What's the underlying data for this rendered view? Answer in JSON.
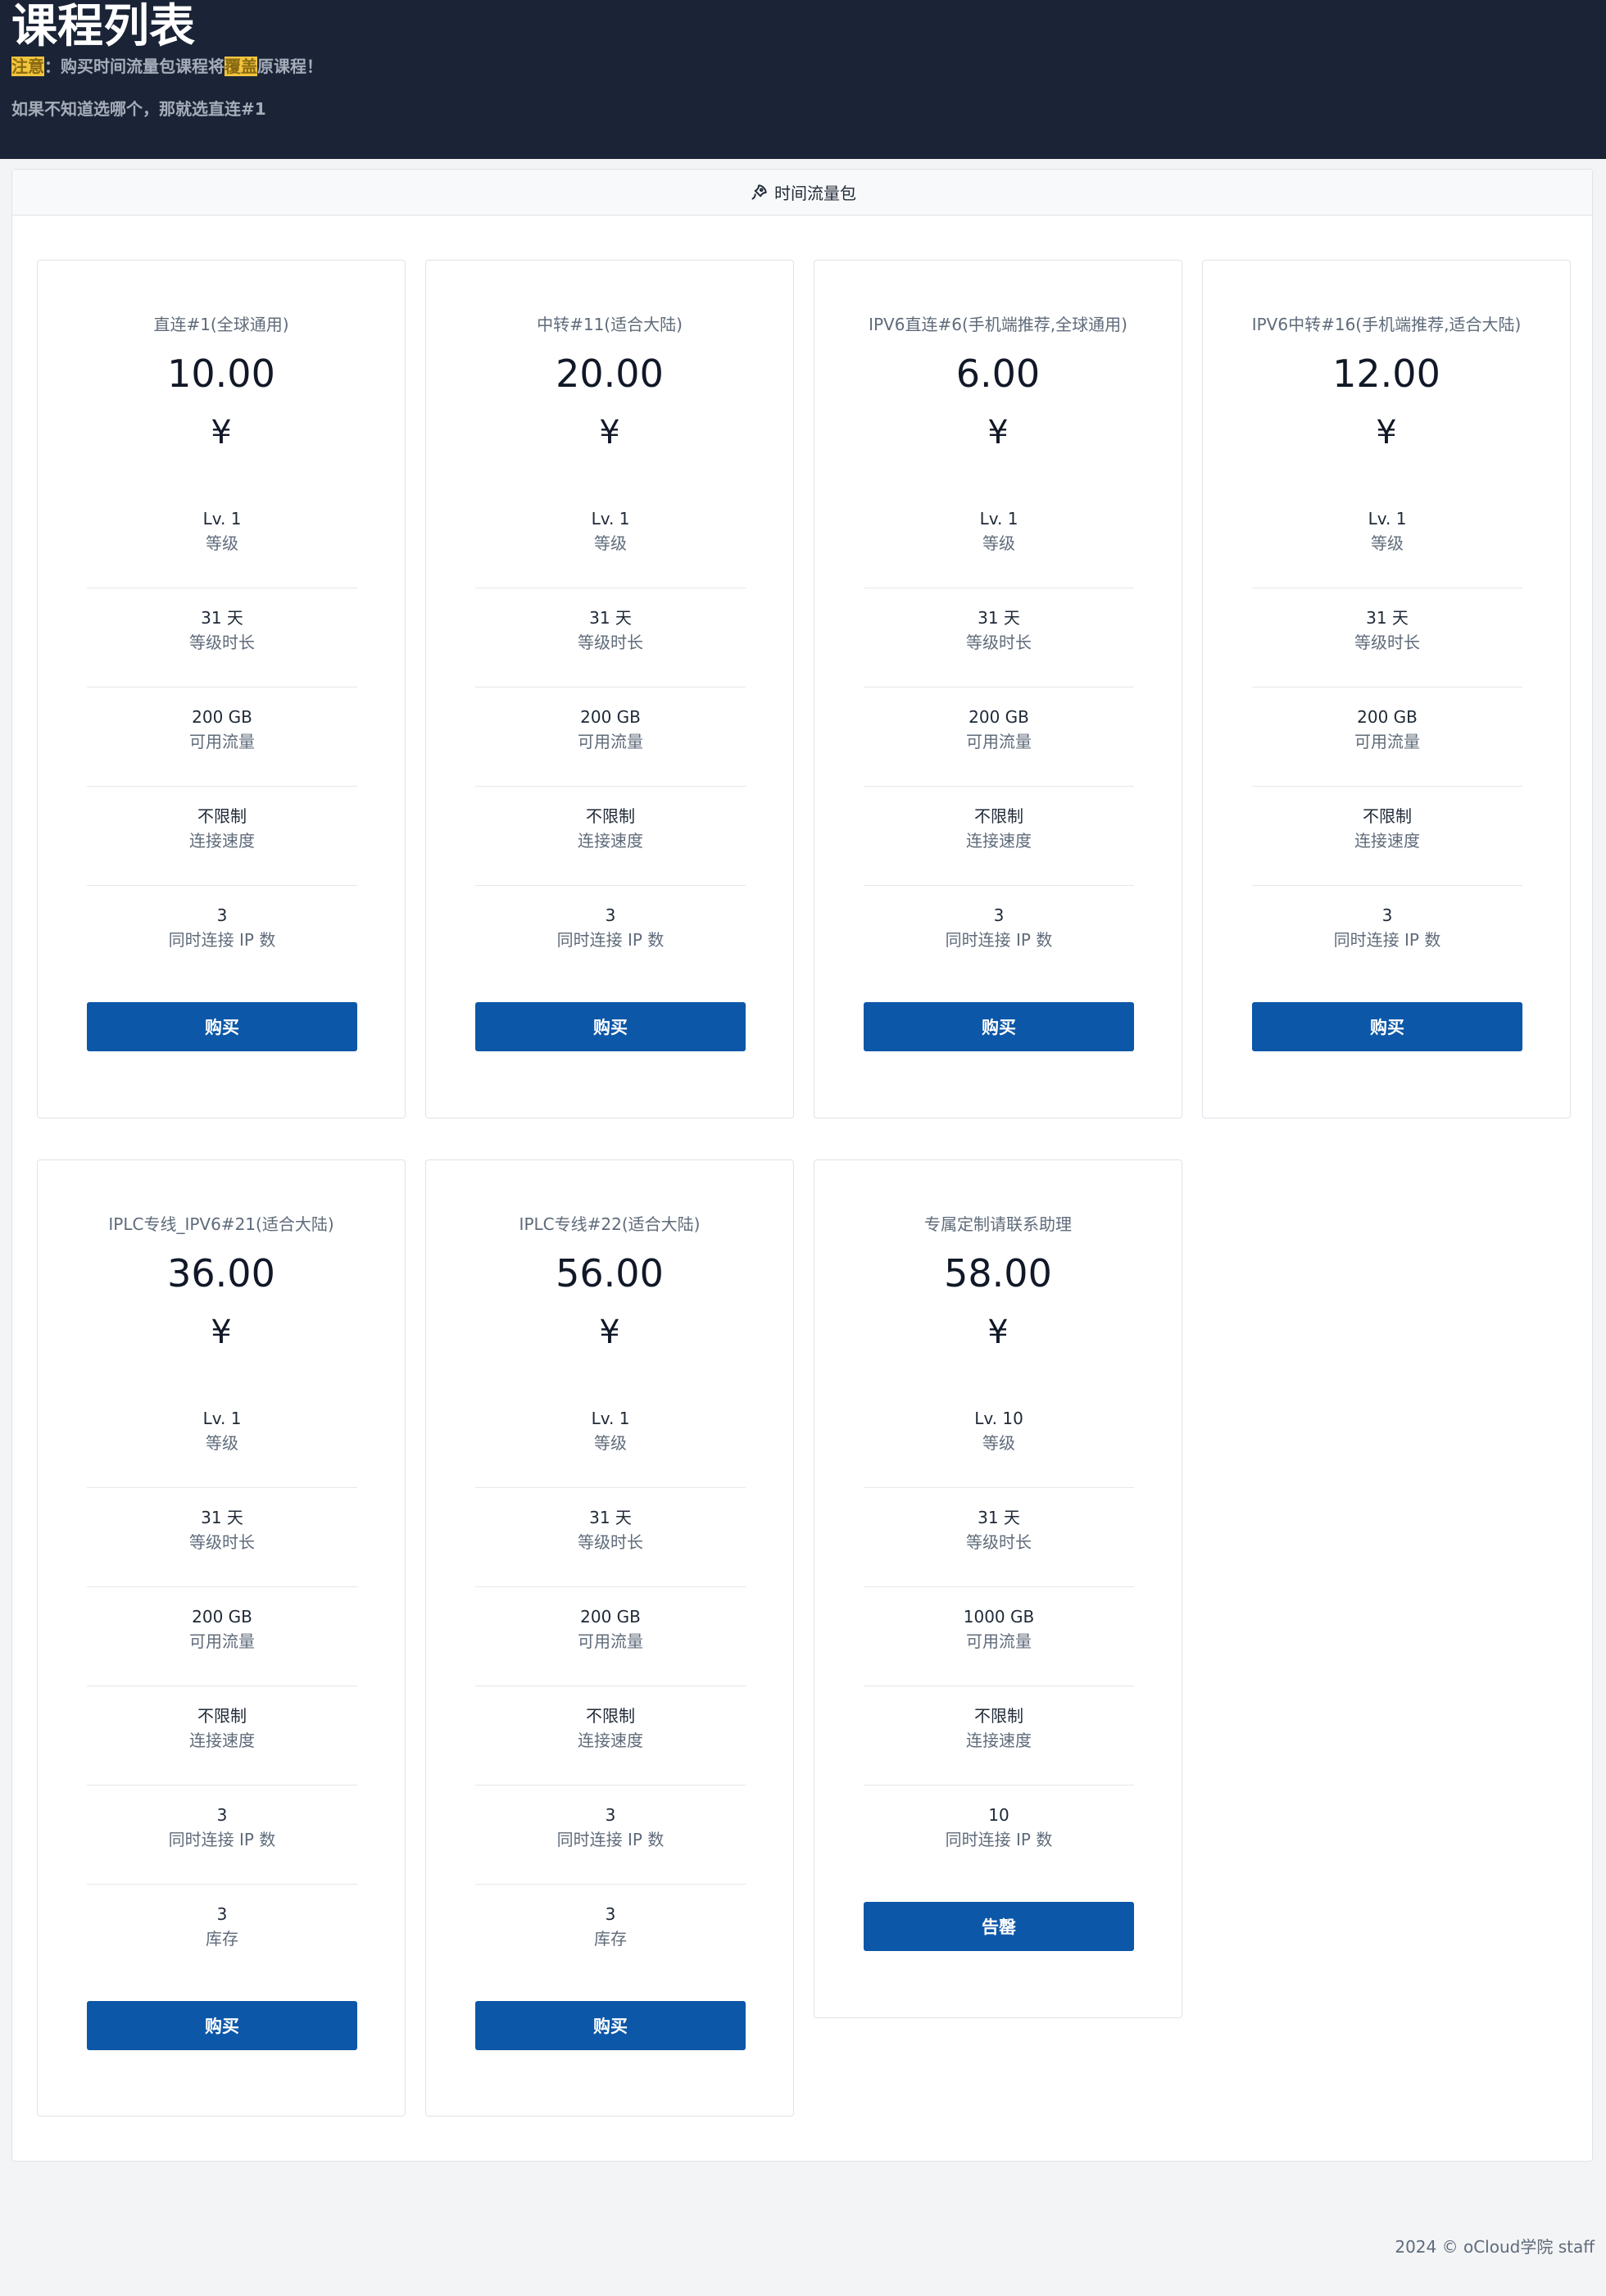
{
  "header": {
    "title": "课程列表",
    "notice_prefix": "注意",
    "notice_mid": "：购买时间流量包课程将",
    "notice_highlight": "覆盖",
    "notice_suffix": "原课程！",
    "hint": "如果不知道选哪个，那就选直连#1"
  },
  "tab": {
    "label": "时间流量包",
    "icon": "rocket-icon"
  },
  "labels": {
    "level": "等级",
    "duration": "等级时长",
    "traffic": "可用流量",
    "speed": "连接速度",
    "ip_count": "同时连接 IP 数",
    "stock": "库存"
  },
  "plans": [
    {
      "name": "直连#1(全球通用)",
      "price": "10.00",
      "currency": "¥",
      "level": "Lv. 1",
      "duration": "31 天",
      "traffic": "200 GB",
      "speed": "不限制",
      "ip_count": "3",
      "button": "购买"
    },
    {
      "name": "中转#11(适合大陆)",
      "price": "20.00",
      "currency": "¥",
      "level": "Lv. 1",
      "duration": "31 天",
      "traffic": "200 GB",
      "speed": "不限制",
      "ip_count": "3",
      "button": "购买"
    },
    {
      "name": "IPV6直连#6(手机端推荐,全球通用)",
      "price": "6.00",
      "currency": "¥",
      "level": "Lv. 1",
      "duration": "31 天",
      "traffic": "200 GB",
      "speed": "不限制",
      "ip_count": "3",
      "button": "购买"
    },
    {
      "name": "IPV6中转#16(手机端推荐,适合大陆)",
      "price": "12.00",
      "currency": "¥",
      "level": "Lv. 1",
      "duration": "31 天",
      "traffic": "200 GB",
      "speed": "不限制",
      "ip_count": "3",
      "button": "购买"
    },
    {
      "name": "IPLC专线_IPV6#21(适合大陆)",
      "price": "36.00",
      "currency": "¥",
      "level": "Lv. 1",
      "duration": "31 天",
      "traffic": "200 GB",
      "speed": "不限制",
      "ip_count": "3",
      "stock": "3",
      "button": "购买"
    },
    {
      "name": "IPLC专线#22(适合大陆)",
      "price": "56.00",
      "currency": "¥",
      "level": "Lv. 1",
      "duration": "31 天",
      "traffic": "200 GB",
      "speed": "不限制",
      "ip_count": "3",
      "stock": "3",
      "button": "购买"
    },
    {
      "name": "专属定制请联系助理",
      "price": "58.00",
      "currency": "¥",
      "level": "Lv. 10",
      "duration": "31 天",
      "traffic": "1000 GB",
      "speed": "不限制",
      "ip_count": "10",
      "button": "告罄"
    }
  ],
  "footer": {
    "text": "2024 © oCloud学院 staff"
  },
  "colors": {
    "header_bg": "#1b2436",
    "button_bg": "#0d57a8",
    "highlight": "#f2c53d"
  }
}
